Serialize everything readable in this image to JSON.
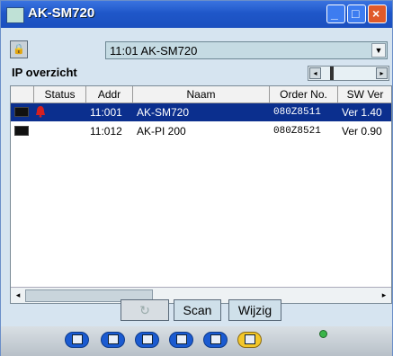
{
  "window": {
    "title": "AK-SM720"
  },
  "selector": {
    "value": "11:01 AK-SM720"
  },
  "section": {
    "title": "IP overzicht"
  },
  "table": {
    "headers": [
      "",
      "Status",
      "Addr",
      "Naam",
      "Order No.",
      "SW Ver"
    ],
    "rows": [
      {
        "status": "alarm",
        "addr": "11:001",
        "naam": "AK-SM720",
        "order": "080Z8511",
        "sw": "Ver 1.40"
      },
      {
        "status": "",
        "addr": "11:012",
        "naam": "AK-PI 200",
        "order": "080Z8521",
        "sw": "Ver 0.90"
      }
    ]
  },
  "buttons": {
    "scan": "Scan",
    "wijzig": "Wijzig"
  },
  "icons": {
    "alarm": "alarm-bell-icon",
    "refresh": "refresh-icon",
    "lock": "lock-icon"
  },
  "colors": {
    "selection": "#0b2f8e",
    "titlebar": "#1f57c9",
    "alarm": "#d42020"
  }
}
